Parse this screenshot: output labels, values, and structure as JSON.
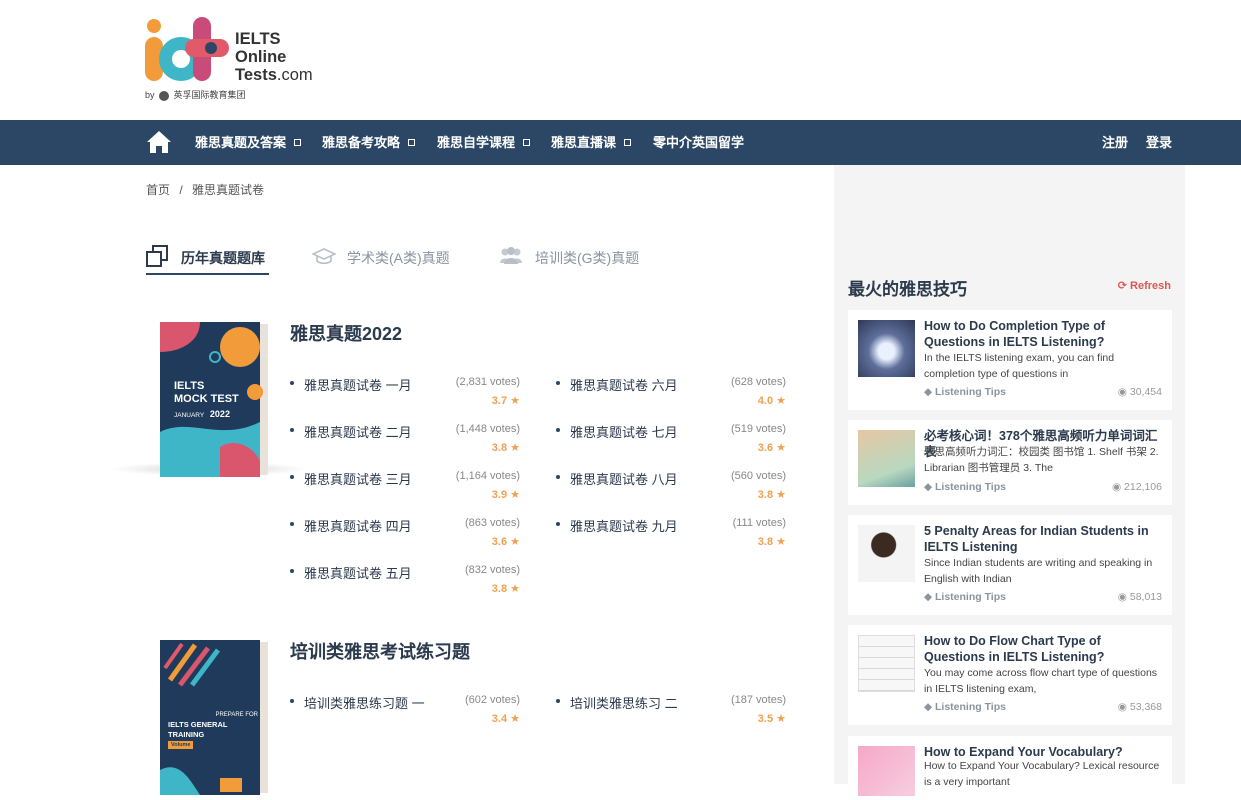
{
  "logo": {
    "line1": "IELTS",
    "line2": "Online",
    "line3": "Tests",
    "line3_suffix": ".com",
    "by": "by",
    "org": "英孚国际教育集团"
  },
  "nav": {
    "items": [
      "雅思真题及答案",
      "雅思备考攻略",
      "雅思自学课程",
      "雅思直播课",
      "零中介英国留学"
    ],
    "register": "注册",
    "login": "登录"
  },
  "breadcrumb": {
    "home": "首页",
    "sep": "/",
    "current": "雅思真题试卷"
  },
  "tabs": [
    "历年真题题库",
    "学术类(A类)真题",
    "培训类(G类)真题"
  ],
  "sections": [
    {
      "title": "雅思真题2022",
      "book": {
        "line1": "IELTS",
        "line2": "MOCK TEST",
        "month": "JANUARY",
        "year": "2022"
      },
      "items": [
        {
          "name": "雅思真题试卷 一月",
          "votes": "(2,831 votes)",
          "rating": "3.7"
        },
        {
          "name": "雅思真题试卷 二月",
          "votes": "(1,448 votes)",
          "rating": "3.8"
        },
        {
          "name": "雅思真题试卷 三月",
          "votes": "(1,164 votes)",
          "rating": "3.9"
        },
        {
          "name": "雅思真题试卷 四月",
          "votes": "(863 votes)",
          "rating": "3.6"
        },
        {
          "name": "雅思真题试卷 五月",
          "votes": "(832 votes)",
          "rating": "3.8"
        },
        {
          "name": "雅思真题试卷 六月",
          "votes": "(628 votes)",
          "rating": "4.0"
        },
        {
          "name": "雅思真题试卷 七月",
          "votes": "(519 votes)",
          "rating": "3.6"
        },
        {
          "name": "雅思真题试卷 八月",
          "votes": "(560 votes)",
          "rating": "3.8"
        },
        {
          "name": "雅思真题试卷 九月",
          "votes": "(111 votes)",
          "rating": "3.8"
        }
      ]
    },
    {
      "title": "培训类雅思考试练习题",
      "book": {
        "line1": "PREPARE FOR",
        "line2": "IELTS GENERAL TRAINING",
        "month": "Volume",
        "year": ""
      },
      "items": [
        {
          "name": "培训类雅思练习题 一",
          "votes": "(602 votes)",
          "rating": "3.4"
        },
        {
          "name": "培训类雅思练习 二",
          "votes": "(187 votes)",
          "rating": "3.5"
        }
      ]
    }
  ],
  "sidebar": {
    "title": "最火的雅思技巧",
    "refresh": "Refresh",
    "cards": [
      {
        "title": "How to Do Completion Type of Questions in IELTS Listening?",
        "desc": "In the IELTS listening exam, you can find completion type of questions in",
        "tag": "Listening Tips",
        "views": "30,454"
      },
      {
        "title": "必考核心词！378个雅思高频听力单词词汇表",
        "desc": "雅思高频听力词汇：校园类 图书馆 1. Shelf 书架 2. Librarian 图书管理员 3. The",
        "tag": "Listening Tips",
        "views": "212,106"
      },
      {
        "title": "5 Penalty Areas for Indian Students in IELTS Listening",
        "desc": "Since Indian students are writing and speaking in English with Indian",
        "tag": "Listening Tips",
        "views": "58,013"
      },
      {
        "title": "How to Do Flow Chart Type of Questions in IELTS Listening?",
        "desc": "You may come across flow chart type of questions in IELTS listening exam,",
        "tag": "Listening Tips",
        "views": "53,368"
      },
      {
        "title": "How to Expand Your Vocabulary?",
        "desc": "How to Expand Your Vocabulary? Lexical resource is a very important",
        "tag": "",
        "views": ""
      }
    ]
  },
  "colors": {
    "nav_bg": "#2c4765",
    "accent": "#f0a050",
    "refresh": "#e05555",
    "sidebar_bg": "#f4f4f4"
  }
}
